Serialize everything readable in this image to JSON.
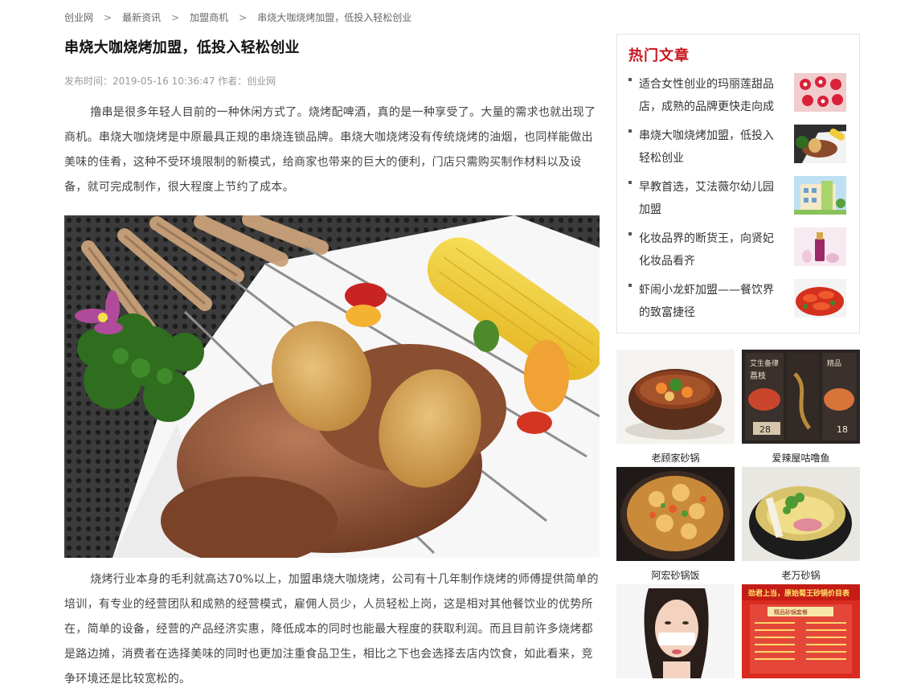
{
  "breadcrumb": {
    "items": [
      "创业网",
      "最新资讯",
      "加盟商机",
      "串烧大咖烧烤加盟，低投入轻松创业"
    ],
    "separator": ">"
  },
  "article": {
    "title": "串烧大咖烧烤加盟，低投入轻松创业",
    "meta": "发布时间：2019-05-16 10:36:47 作者：创业网",
    "paragraphs": [
      "撸串是很多年轻人目前的一种休闲方式了。烧烤配啤酒，真的是一种享受了。大量的需求也就出现了商机。串烧大咖烧烤是中原最具正规的串烧连锁品牌。串烧大咖烧烤没有传统烧烤的油烟，也同样能做出美味的佳肴，这种不受环境限制的新模式，给商家也带来的巨大的便利，门店只需购买制作材料以及设备，就可完成制作，很大程度上节约了成本。",
      "烧烤行业本身的毛利就高达70%以上，加盟串烧大咖烧烤，公司有十几年制作烧烤的师傅提供简单的培训，有专业的经营团队和成熟的经营模式，雇佣人员少，人员轻松上岗，这是相对其他餐饮业的优势所在，简单的设备，经营的产品经济实惠，降低成本的同时也能最大程度的获取利润。而且目前许多烧烤都是路边摊，消费者在选择美味的同时也更加注重食品卫生，相比之下也会选择去店内饮食，如此看来，竞争环境还是比较宽松的。"
    ]
  },
  "sidebar": {
    "hot_title": "热门文章",
    "hot_items": [
      {
        "title": "适合女性创业的玛丽莲甜品店，成熟的品牌更快走向成",
        "thumb": "strawberry-dessert"
      },
      {
        "title": "串烧大咖烧烤加盟，低投入轻松创业",
        "thumb": "bbq-skewers"
      },
      {
        "title": "早教首选，艾法薇尔幼儿园加盟",
        "thumb": "kindergarten-building"
      },
      {
        "title": "化妆品界的断货王，向贤妃化妆品看齐",
        "thumb": "cosmetics-bottle"
      },
      {
        "title": "虾闹小龙虾加盟——餐饮界的致富捷径",
        "thumb": "crayfish-dish"
      }
    ],
    "thumbs": [
      {
        "caption": "老顾家砂锅"
      },
      {
        "caption": "爱辣屋咕噜鱼"
      },
      {
        "caption": "阿宏砂锅饭"
      },
      {
        "caption": "老万砂锅"
      },
      {
        "caption": ""
      },
      {
        "caption": ""
      }
    ],
    "menu_board": {
      "headline": "劲君上当，原始蜀王砂锅价目表",
      "tag": "精品砂锅套餐"
    },
    "poster": {
      "tags": [
        "艾生备律",
        "荔枝",
        "精品"
      ],
      "price_left": "28",
      "price_right": "18"
    }
  },
  "colors": {
    "accent": "#c8161e",
    "text": "#333333",
    "muted": "#999999",
    "border": "#e3e3e3"
  }
}
